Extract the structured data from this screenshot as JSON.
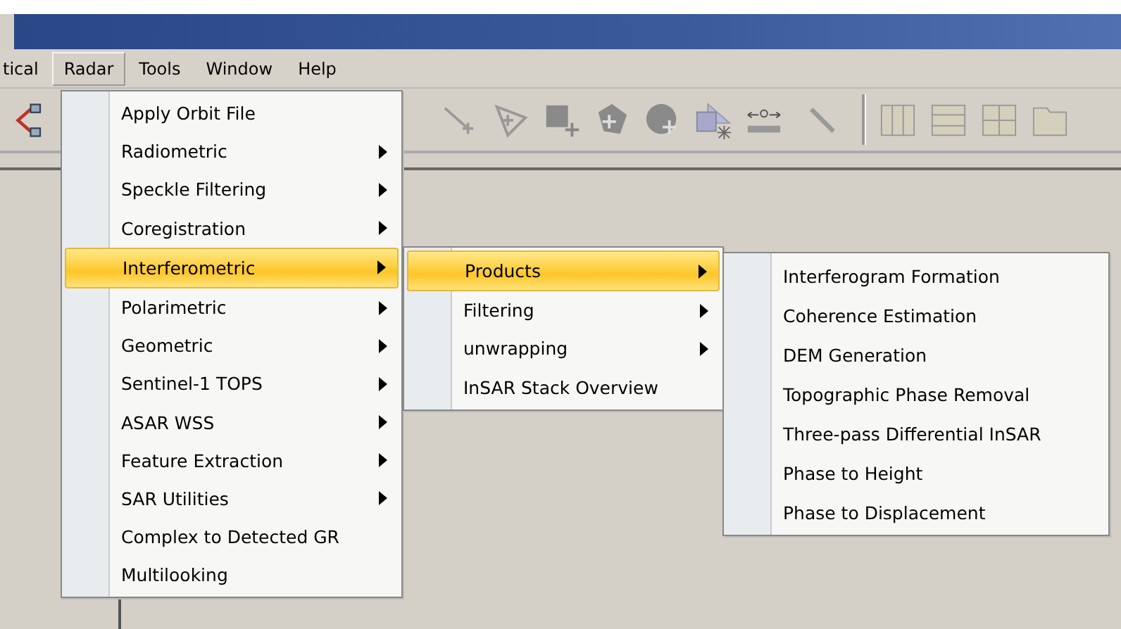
{
  "menubar": [
    {
      "label": "tical",
      "selected": false
    },
    {
      "label": "Radar",
      "selected": true
    },
    {
      "label": "Tools",
      "selected": false
    },
    {
      "label": "Window",
      "selected": false
    },
    {
      "label": "Help",
      "selected": false
    }
  ],
  "radar_menu": [
    {
      "label": "Apply Orbit File",
      "has_submenu": false,
      "selected": false
    },
    {
      "label": "Radiometric",
      "has_submenu": true,
      "selected": false
    },
    {
      "label": "Speckle Filtering",
      "has_submenu": true,
      "selected": false
    },
    {
      "label": "Coregistration",
      "has_submenu": true,
      "selected": false
    },
    {
      "label": "Interferometric",
      "has_submenu": true,
      "selected": true
    },
    {
      "label": "Polarimetric",
      "has_submenu": true,
      "selected": false
    },
    {
      "label": "Geometric",
      "has_submenu": true,
      "selected": false
    },
    {
      "label": "Sentinel-1 TOPS",
      "has_submenu": true,
      "selected": false
    },
    {
      "label": "ASAR WSS",
      "has_submenu": true,
      "selected": false
    },
    {
      "label": "Feature Extraction",
      "has_submenu": true,
      "selected": false
    },
    {
      "label": "SAR Utilities",
      "has_submenu": true,
      "selected": false
    },
    {
      "label": "Complex to Detected GR",
      "has_submenu": false,
      "selected": false
    },
    {
      "label": "Multilooking",
      "has_submenu": false,
      "selected": false
    }
  ],
  "interferometric_menu": [
    {
      "label": "Products",
      "has_submenu": true,
      "selected": true
    },
    {
      "label": "Filtering",
      "has_submenu": true,
      "selected": false
    },
    {
      "label": "unwrapping",
      "has_submenu": true,
      "selected": false
    },
    {
      "label": "InSAR Stack Overview",
      "has_submenu": false,
      "selected": false
    }
  ],
  "products_menu": [
    {
      "label": "Interferogram Formation",
      "has_submenu": false,
      "selected": false
    },
    {
      "label": "Coherence Estimation",
      "has_submenu": false,
      "selected": false
    },
    {
      "label": "DEM Generation",
      "has_submenu": false,
      "selected": false
    },
    {
      "label": "Topographic Phase Removal",
      "has_submenu": false,
      "selected": false
    },
    {
      "label": "Three-pass Differential InSAR",
      "has_submenu": false,
      "selected": false
    },
    {
      "label": "Phase to Height",
      "has_submenu": false,
      "selected": false
    },
    {
      "label": "Phase to Displacement",
      "has_submenu": false,
      "selected": false
    }
  ]
}
